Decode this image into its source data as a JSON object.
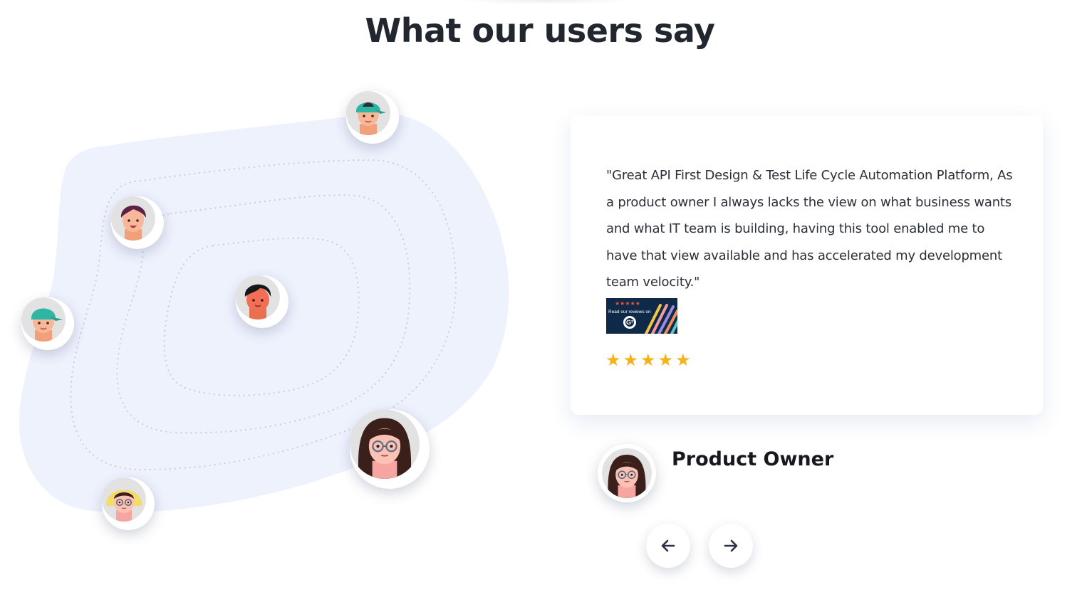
{
  "section": {
    "title": "What our users say"
  },
  "testimonial": {
    "quote": "\"Great API First Design & Test Life Cycle Automation Platform, As a product owner I always lacks the view on what business wants and what IT team is building, having this tool enabled me to have that view available and has accelerated my development team velocity.\"",
    "badge": {
      "stars": "★★★★★",
      "text": "Read our reviews on",
      "logo": "G²"
    },
    "rating": 5,
    "reviewer_role": "Product Owner"
  },
  "navigation": {
    "prev_icon": "arrow-left-icon",
    "next_icon": "arrow-right-icon"
  },
  "colors": {
    "blob": "#eef2fd",
    "star": "#f6b319",
    "badge_bg": "#0e2a48",
    "title": "#22262e"
  }
}
